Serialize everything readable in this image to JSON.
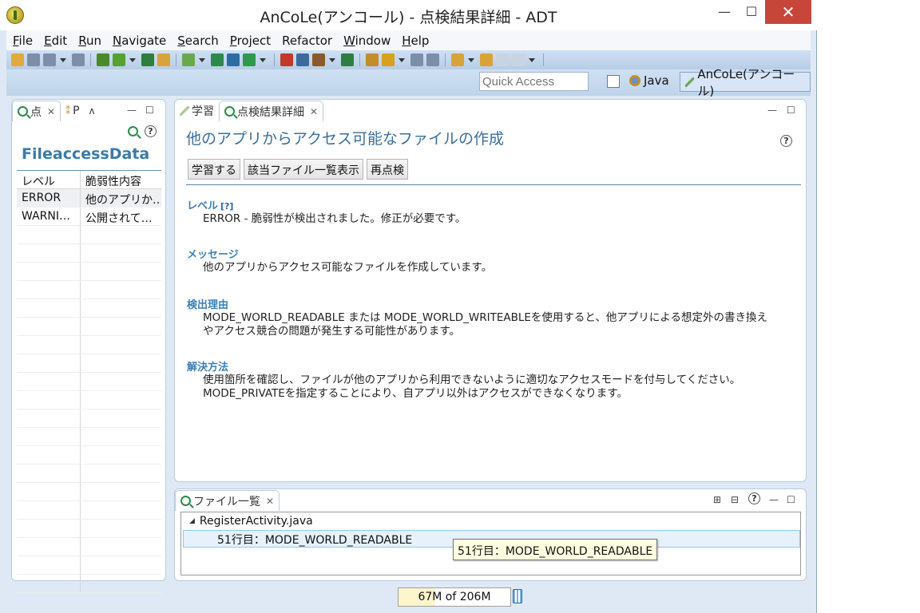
{
  "window": {
    "title": "AnCoLe(アンコール) - 点検結果詳細 - ADT",
    "minimize": "—",
    "maximize": "☐",
    "close": "✕"
  },
  "menu": [
    {
      "label": "File",
      "mnemonic": "F",
      "rest": "ile"
    },
    {
      "label": "Edit",
      "mnemonic": "E",
      "rest": "dit"
    },
    {
      "label": "Run",
      "mnemonic": "R",
      "rest": "un"
    },
    {
      "label": "Navigate",
      "mnemonic": "N",
      "rest": "avigate"
    },
    {
      "label": "Search",
      "mnemonic": "S",
      "rest": "earch"
    },
    {
      "label": "Project",
      "mnemonic": "P",
      "rest": "roject"
    },
    {
      "label": "Refactor",
      "mnemonic": "",
      "rest": "Refactor"
    },
    {
      "label": "Window",
      "mnemonic": "W",
      "rest": "indow"
    },
    {
      "label": "Help",
      "mnemonic": "H",
      "rest": "elp"
    }
  ],
  "toolbar": {
    "icon_colors": [
      "#e2a93a",
      "#7c8ea8",
      "#7c8ea8",
      "#7c8ea8",
      "#4a8a2a",
      "#57a132",
      "#2f7d3f",
      "#d9a33a",
      "#6aa84f",
      "#2c8a4a",
      "#2e6da4",
      "#2c9a4a",
      "#c0392b",
      "#3d6a9a",
      "#8a5a2a",
      "#2f7d3f",
      "#c58d2a",
      "#d6a11d",
      "#7c8ea8",
      "#7c8ea8",
      "#d9a33a",
      "#d9a33a",
      "#c9d4e3",
      "#c9d4e3"
    ]
  },
  "perspectives": {
    "quick_access_placeholder": "Quick Access",
    "java_label": "Java",
    "ancole_label": "AnCoLe(アンコール)"
  },
  "left_panel": {
    "tab1_label": "点",
    "tab2_label": "P",
    "tab3_label": "",
    "title": "FileaccessData",
    "columns": [
      "レベル",
      "脆弱性内容"
    ],
    "rows": [
      [
        "ERROR",
        "他のアプリか…"
      ],
      [
        "WARNI…",
        "公開されて…"
      ]
    ]
  },
  "detail_panel": {
    "tab_inactive_label": "学習",
    "tab_active_label": "点検結果詳細",
    "heading": "他のアプリからアクセス可能なファイルの作成",
    "buttons": {
      "learn": "学習する",
      "show_files": "該当ファイル一覧表示",
      "recheck": "再点検"
    },
    "level": {
      "heading": "レベル",
      "help_link": "[?]",
      "text": "ERROR - 脆弱性が検出されました。修正が必要です。"
    },
    "message": {
      "heading": "メッセージ",
      "text": "他のアプリからアクセス可能なファイルを作成しています。"
    },
    "reason": {
      "heading": "検出理由",
      "line1": "MODE_WORLD_READABLE または MODE_WORLD_WRITEABLEを使用すると、他アプリによる想定外の書き換え",
      "line2": "やアクセス競合の問題が発生する可能性があります。"
    },
    "solution": {
      "heading": "解決方法",
      "line1": "使用箇所を確認し、ファイルが他のアプリから利用できないように適切なアクセスモードを付与してください。",
      "line2": "MODE_PRIVATEを指定することにより、自アプリ以外はアクセスができなくなります。"
    }
  },
  "files_panel": {
    "tab_label": "ファイル一覧",
    "file": "RegisterActivity.java",
    "item": "51行目：MODE_WORLD_READABLE",
    "tooltip": "51行目：MODE_WORLD_READABLE"
  },
  "status": {
    "heap": "67M of 206M",
    "heap_used_fraction": 0.33
  }
}
